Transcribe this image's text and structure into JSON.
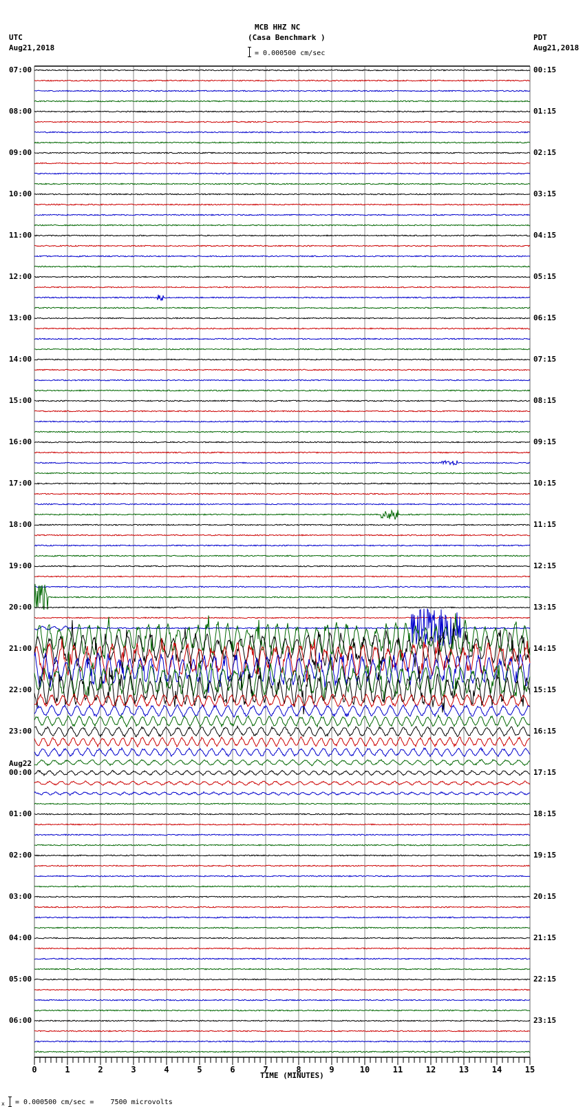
{
  "header": {
    "station": "MCB HHZ NC",
    "location": "(Casa Benchmark )",
    "left_zone": "UTC",
    "left_date": "Aug21,2018",
    "right_zone": "PDT",
    "right_date": "Aug21,2018",
    "scale_text": "= 0.000500 cm/sec"
  },
  "footer": {
    "marker": "x",
    "scale_text": "= 0.000500 cm/sec =    7500 microvolts"
  },
  "chart_data": {
    "type": "line",
    "title": "MCB HHZ NC (Casa Benchmark )",
    "xlabel": "TIME (MINUTES)",
    "xlim": [
      0,
      15
    ],
    "x_ticks": [
      "0",
      "1",
      "2",
      "3",
      "4",
      "5",
      "6",
      "7",
      "8",
      "9",
      "10",
      "11",
      "12",
      "13",
      "14",
      "15"
    ],
    "left_labels": [
      "07:00",
      "08:00",
      "09:00",
      "10:00",
      "11:00",
      "12:00",
      "13:00",
      "14:00",
      "15:00",
      "16:00",
      "17:00",
      "18:00",
      "19:00",
      "20:00",
      "21:00",
      "22:00",
      "23:00",
      "00:00",
      "01:00",
      "02:00",
      "03:00",
      "04:00",
      "05:00",
      "06:00"
    ],
    "left_date_change": {
      "label": "Aug22",
      "before_hour_index": 17
    },
    "right_labels": [
      "00:15",
      "01:15",
      "02:15",
      "03:15",
      "04:15",
      "05:15",
      "06:15",
      "07:15",
      "08:15",
      "09:15",
      "10:15",
      "11:15",
      "12:15",
      "13:15",
      "14:15",
      "15:15",
      "16:15",
      "17:15",
      "18:15",
      "19:15",
      "20:15",
      "21:15",
      "22:15",
      "23:15"
    ],
    "traces_per_hour": 4,
    "trace_colors": [
      "#000000",
      "#cc0000",
      "#0000cc",
      "#006600"
    ],
    "grid": true,
    "events": [
      {
        "row": 51,
        "start_min": 0.0,
        "end_min": 0.4,
        "amplitude": 20
      },
      {
        "row": 54,
        "start_min": 11.4,
        "end_min": 12.9,
        "amplitude": 28
      },
      {
        "row": 22,
        "start_min": 3.7,
        "end_min": 3.9,
        "amplitude": 5
      },
      {
        "row": 38,
        "start_min": 12.3,
        "end_min": 12.8,
        "amplitude": 3
      },
      {
        "row": 43,
        "start_min": 10.5,
        "end_min": 11.0,
        "amplitude": 8
      }
    ],
    "teleseism": {
      "start_row": 54,
      "peak_rows": [
        55,
        60
      ],
      "end_row": 70,
      "peak_amplitude": 26
    }
  }
}
